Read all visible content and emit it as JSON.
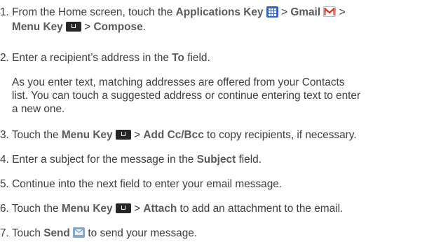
{
  "steps": [
    {
      "lines": [
        {
          "p1": "1. From the Home screen, touch the ",
          "b1": "Applications Key",
          "p2": " > ",
          "b2": "Gmail",
          "p3": " >"
        },
        {
          "b1": "Menu Key",
          "p1": " > ",
          "b2": "Compose",
          "p2": "."
        }
      ]
    },
    {
      "p1": "2. Enter a recipient’s address in the ",
      "b1": "To",
      "p2": " field."
    },
    {
      "p1": "3. Touch the ",
      "b1": "Menu Key",
      "p2": " > ",
      "b2": "Add Cc/Bcc",
      "p3": " to copy recipients, if necessary."
    },
    {
      "p1": "4. Enter a subject for the message in the ",
      "b1": "Subject",
      "p2": " field."
    },
    {
      "p1": "5. Continue into the next field to enter your email message."
    },
    {
      "p1": "6. Touch the ",
      "b1": "Menu Key",
      "p2": " > ",
      "b2": "Attach",
      "p3": " to add an attachment to the email."
    },
    {
      "p1": "7. Touch ",
      "b1": "Send",
      "p2": " to send your message."
    }
  ],
  "note": [
    "As you enter text, matching addresses are offered from your Contacts",
    "list. You can touch a suggested address or continue entering text to enter",
    "a new one."
  ],
  "icons": {
    "apps_color": "#2f66c8",
    "gmail_color": "#d93025",
    "menu_color": "#262626",
    "send_color": "#8aa6c9"
  }
}
